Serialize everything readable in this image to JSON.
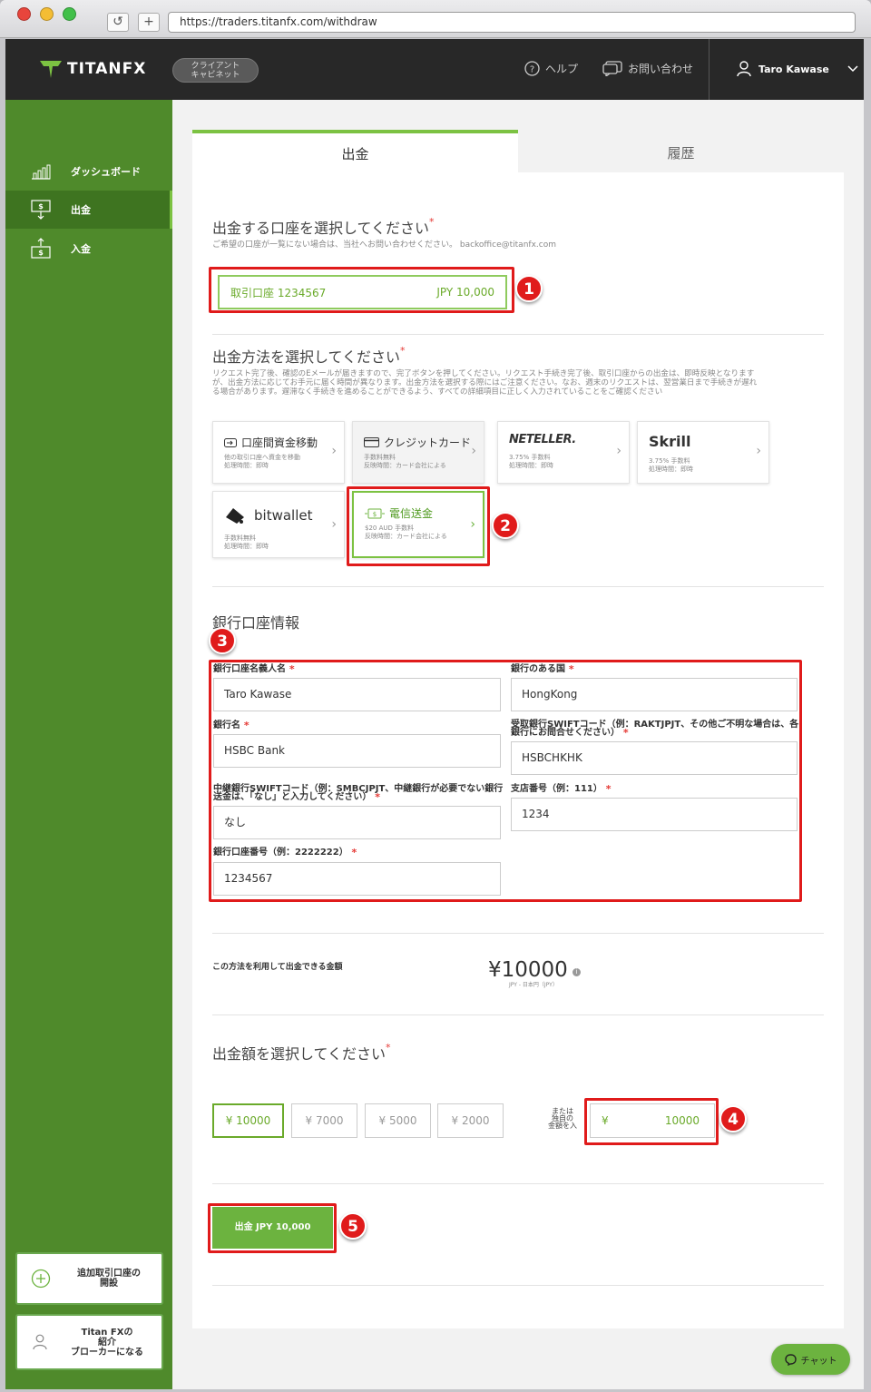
{
  "browser": {
    "url": "https://traders.titanfx.com/withdraw",
    "reload_label": "↺",
    "newtab_label": "+"
  },
  "topnav": {
    "logo_text": "TITANFX",
    "cabinet_line1": "クライアント",
    "cabinet_line2": "キャビネット",
    "help": "ヘルプ",
    "contact": "お問い合わせ",
    "user_name": "Taro Kawase"
  },
  "sidebar": {
    "items": [
      {
        "label": "ダッシュボード"
      },
      {
        "label": "出金"
      },
      {
        "label": "入金"
      }
    ],
    "add_account_line1": "追加取引口座の",
    "add_account_line2": "開設",
    "referral_line1": "Titan FXの",
    "referral_line2": "紹介",
    "referral_line3": "ブローカーになる"
  },
  "tabs": {
    "withdraw": "出金",
    "history": "履歴"
  },
  "account_section": {
    "title": "出金する口座を選択してください",
    "required_mark": "*",
    "note": "ご希望の口座が一覧にない場合は、当社へお問い合わせください。 backoffice@titanfx.com",
    "account_name": "取引口座 1234567",
    "account_balance": "JPY 10,000"
  },
  "method_section": {
    "title": "出金方法を選択してください",
    "required_mark": "*",
    "note_line1": "リクエスト完了後、確認のEメールが届きますので、完了ボタンを押してください。リクエスト手続き完了後、取引口座からの出金は、即時反映となります",
    "note_line2": "が、出金方法に応じてお手元に届く時間が異なります。出金方法を選択する際にはご注意ください。なお、週末のリクエストは、翌営業日まで手続きが遅れ",
    "note_line3": "る場合があります。遅滞なく手続きを進めることができるよう、すべての詳細項目に正しく入力されていることをご確認ください",
    "methods": [
      {
        "title": "口座間資金移動",
        "sub1": "他の取引口座へ資金を移動",
        "sub2": "処理時間：即時"
      },
      {
        "title": "クレジットカード",
        "sub1": "手数料無料",
        "sub2": "反映時間：カード会社による"
      },
      {
        "title": "NETELLER.",
        "sub1": "3.75% 手数料",
        "sub2": "処理時間：即時"
      },
      {
        "title": "Skrill",
        "sub1": "3.75% 手数料",
        "sub2": "処理時間：即時"
      },
      {
        "title": "bitwallet",
        "sub1": "手数料無料",
        "sub2": "処理時間：即時"
      },
      {
        "title": "電信送金",
        "sub1": "$20 AUD 手数料",
        "sub2": "反映時間：カード会社による"
      }
    ]
  },
  "bank_section": {
    "title": "銀行口座情報",
    "fields": {
      "holder_label": "銀行口座名義人名",
      "holder_value": "Taro Kawase",
      "country_label": "銀行のある国",
      "country_value": "HongKong",
      "bank_label": "銀行名",
      "bank_value": "HSBC Bank",
      "swift_label_1": "受取銀行SWIFTコード（例：RAKTJPJT、その他ご不明な場合は、各",
      "swift_label_2": "銀行にお問合せください）",
      "swift_value": "HSBCHKHK",
      "inter_label_1": "中継銀行SWIFTコード（例：SMBCJPJT、中継銀行が必要でない銀行",
      "inter_label_2": "送金は、「なし」と入力してください）",
      "inter_value": "なし",
      "branch_label": "支店番号（例：111）",
      "branch_value": "1234",
      "acctno_label": "銀行口座番号（例：2222222）",
      "acctno_value": "1234567"
    }
  },
  "available": {
    "label": "この方法を利用して出金できる金額",
    "amount": "¥10000",
    "sub": "JPY - 日本円（JPY）",
    "info_icon": "i"
  },
  "amount_section": {
    "title": "出金額を選択してください",
    "required_mark": "*",
    "options": [
      "¥ 10000",
      "¥ 7000",
      "¥ 5000",
      "¥ 2000"
    ],
    "custom_label_1": "または",
    "custom_label_2": "独自の",
    "custom_label_3": "金額を入",
    "custom_currency": "¥",
    "custom_value": "10000"
  },
  "submit_label": "出金 JPY 10,000",
  "badges": [
    "1",
    "2",
    "3",
    "4",
    "5"
  ],
  "chat_label": "チャット",
  "colors": {
    "brand_green": "#6cb33f",
    "sidebar_green": "#4f8a2b",
    "highlight_red": "#e01b1b",
    "topnav": "#282828"
  }
}
